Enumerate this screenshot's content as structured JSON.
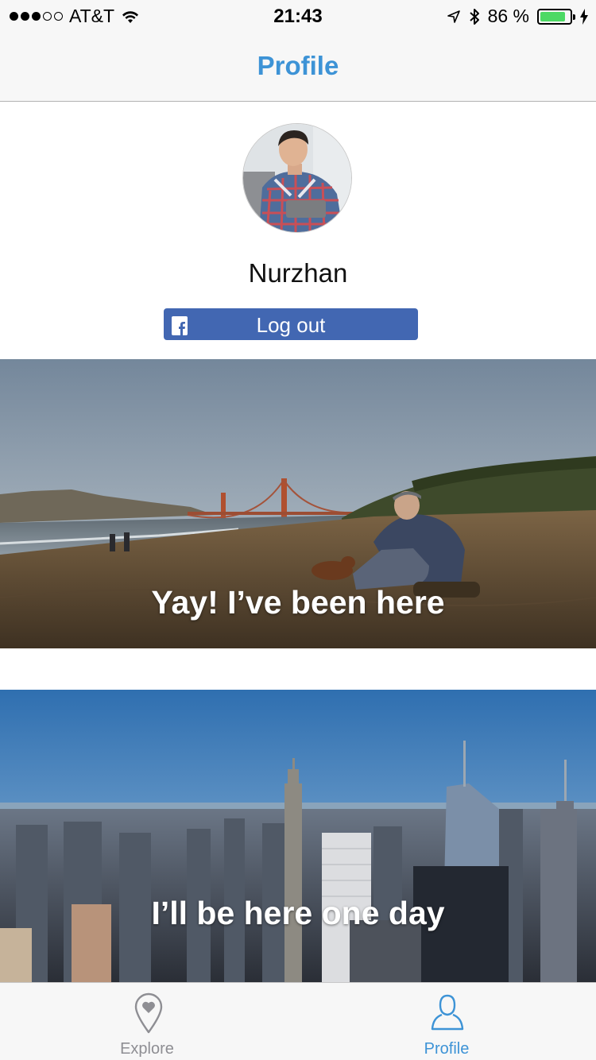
{
  "status_bar": {
    "carrier": "AT&T",
    "time": "21:43",
    "battery_percent_text": "86 %",
    "battery_level": 0.86,
    "signal_bars_filled": 3,
    "signal_bars_total": 5,
    "battery_color": "#4cd964"
  },
  "nav": {
    "title": "Profile",
    "accent_color": "#3d93d6"
  },
  "profile": {
    "username": "Nurzhan",
    "logout_label": "Log out",
    "logout_color": "#4267b2"
  },
  "cards": [
    {
      "caption": "Yay! I’ve been here",
      "icon": "beach-golden-gate-photo"
    },
    {
      "caption": "I’ll be here one day",
      "icon": "city-skyline-photo"
    }
  ],
  "tabs": [
    {
      "label": "Explore",
      "icon": "map-pin-heart-icon",
      "active": false
    },
    {
      "label": "Profile",
      "icon": "person-icon",
      "active": true
    }
  ]
}
